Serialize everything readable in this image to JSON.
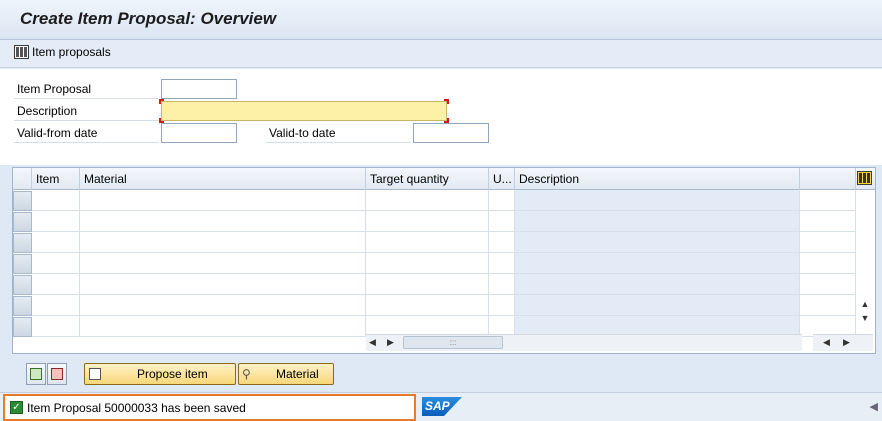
{
  "window": {
    "title": "Create Item Proposal: Overview"
  },
  "toolbar": {
    "item_proposals_label": "Item proposals"
  },
  "form": {
    "item_proposal_label": "Item Proposal",
    "item_proposal_value": "",
    "description_label": "Description",
    "description_value": "",
    "valid_from_label": "Valid-from date",
    "valid_from_value": "",
    "valid_to_label": "Valid-to date",
    "valid_to_value": ""
  },
  "table": {
    "columns": [
      "Item",
      "Material",
      "Target quantity",
      "U...",
      "Description"
    ],
    "row_count": 7
  },
  "buttons": {
    "propose_item": "Propose item",
    "material": "Material"
  },
  "status": {
    "message": "Item Proposal 50000033 has been saved",
    "type": "success"
  },
  "branding": {
    "logo": "SAP"
  },
  "colors": {
    "accent_border": "#e97c2b",
    "success": "#2e8b35",
    "required_field": "#fdf1a8"
  }
}
